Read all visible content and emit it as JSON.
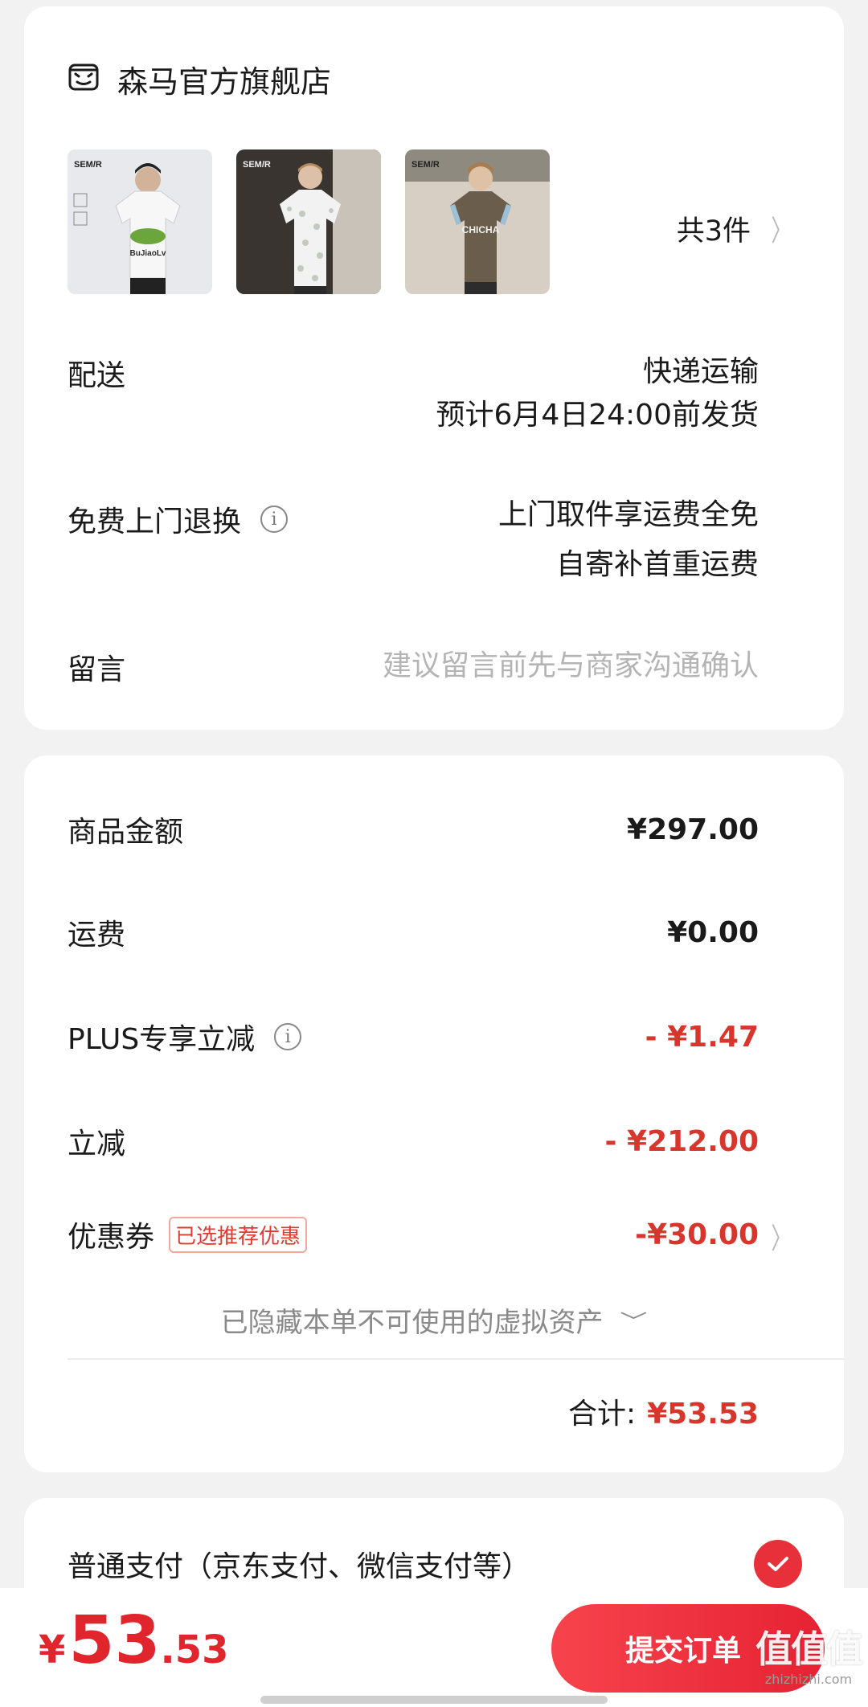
{
  "shop": {
    "name": "森马官方旗舰店",
    "icon": "shop-icon"
  },
  "products": {
    "items": [
      {
        "brand": "SEM/R",
        "graphic_text": "BuJiaoLv",
        "shirt_color": "#f4f4f4",
        "bg": "#e8e9ec"
      },
      {
        "brand": "SEM/R",
        "graphic_text": "",
        "shirt_color": "#f0f0f0",
        "bg": "#3a3430"
      },
      {
        "brand": "SEM/R",
        "graphic_text": "CHICHA",
        "shirt_color": "#6b5d4b",
        "bg": "#d8cfc4"
      }
    ],
    "count_label": "共3件"
  },
  "delivery": {
    "label": "配送",
    "method": "快递运输",
    "eta": "预计6月4日24:00前发货"
  },
  "returns": {
    "label": "免费上门退换",
    "line1": "上门取件享运费全免",
    "line2": "自寄补首重运费"
  },
  "message": {
    "label": "留言",
    "placeholder": "建议留言前先与商家沟通确认"
  },
  "price": {
    "goods_label": "商品金额",
    "goods_value": "¥297.00",
    "shipping_label": "运费",
    "shipping_value": "¥0.00",
    "plus_label": "PLUS专享立减",
    "plus_value": "- ¥1.47",
    "discount_label": "立减",
    "discount_value": "- ¥212.00",
    "coupon_label": "优惠券",
    "coupon_tag": "已选推荐优惠",
    "coupon_value": "-¥30.00",
    "hidden_assets": "已隐藏本单不可使用的虚拟资产",
    "total_label": "合计:",
    "total_value": "¥53.53"
  },
  "payment": {
    "label": "普通支付（京东支付、微信支付等）",
    "selected": true
  },
  "bottom": {
    "currency": "¥",
    "total_int": "53",
    "total_dec": ".53",
    "submit_label": "提交订单"
  },
  "watermark": {
    "logo": "值值值",
    "url": "zhizhizhi.com"
  },
  "colors": {
    "accent_red": "#d8362c",
    "button_red": "#e62233",
    "background": "#f2f2f2"
  }
}
